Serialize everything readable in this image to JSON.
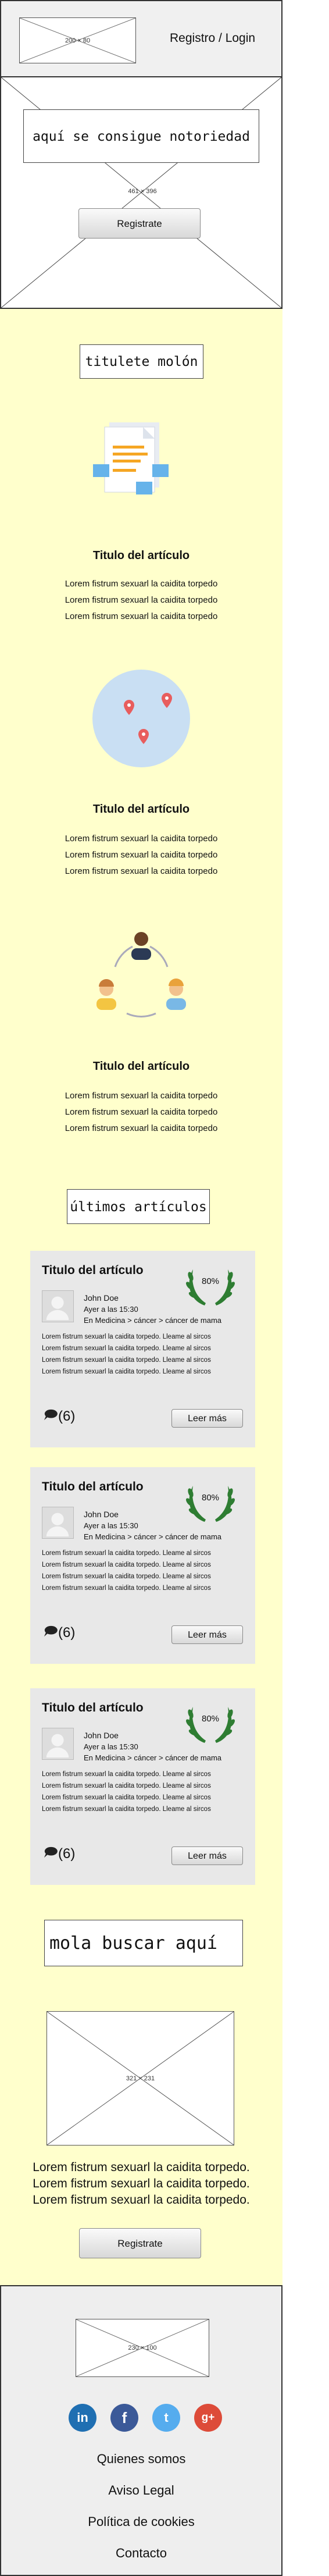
{
  "header": {
    "logo_placeholder": "200 × 80",
    "login_link": "Registro / Login"
  },
  "hero": {
    "headline": "aquí se consigue notoriedad",
    "placeholder_size": "461 × 396",
    "register_button": "Registrate"
  },
  "features": {
    "section_title": "titulete molón",
    "items": [
      {
        "title": "Titulo del artículo",
        "lines": [
          "Lorem fistrum sexuarl la caidita torpedo",
          "Lorem fistrum sexuarl la caidita torpedo",
          "Lorem fistrum sexuarl la caidita torpedo"
        ],
        "icon": "document-icon"
      },
      {
        "title": "Titulo del artículo",
        "lines": [
          "Lorem fistrum sexuarl la caidita torpedo",
          "Lorem fistrum sexuarl la caidita torpedo",
          "Lorem fistrum sexuarl la caidita torpedo"
        ],
        "icon": "map-pins-icon"
      },
      {
        "title": "Titulo del artículo",
        "lines": [
          "Lorem fistrum sexuarl la caidita torpedo",
          "Lorem fistrum sexuarl la caidita torpedo",
          "Lorem fistrum sexuarl la caidita torpedo"
        ],
        "icon": "people-cycle-icon"
      }
    ]
  },
  "latest": {
    "section_title": "últimos artículos",
    "cards": [
      {
        "title": "Titulo del artículo",
        "author": "John Doe",
        "date": "Ayer a las 15:30",
        "category": "En Medicina > cáncer > cáncer de mama",
        "score": "80%",
        "lines": [
          "Lorem fistrum sexuarl la caidita torpedo. Lleame al sircos",
          "Lorem fistrum sexuarl la caidita torpedo. Lleame al sircos",
          "Lorem fistrum sexuarl la caidita torpedo. Lleame al sircos",
          "Lorem fistrum sexuarl la caidita torpedo. Lleame al sircos"
        ],
        "comments": "(6)",
        "read_more": "Leer más"
      },
      {
        "title": "Titulo del artículo",
        "author": "John Doe",
        "date": "Ayer a las 15:30",
        "category": "En Medicina > cáncer > cáncer de mama",
        "score": "80%",
        "lines": [
          "Lorem fistrum sexuarl la caidita torpedo. Lleame al sircos",
          "Lorem fistrum sexuarl la caidita torpedo. Lleame al sircos",
          "Lorem fistrum sexuarl la caidita torpedo. Lleame al sircos",
          "Lorem fistrum sexuarl la caidita torpedo. Lleame al sircos"
        ],
        "comments": "(6)",
        "read_more": "Leer más"
      },
      {
        "title": "Titulo del artículo",
        "author": "John Doe",
        "date": "Ayer a las 15:30",
        "category": "En Medicina > cáncer > cáncer de mama",
        "score": "80%",
        "lines": [
          "Lorem fistrum sexuarl la caidita torpedo. Lleame al sircos",
          "Lorem fistrum sexuarl la caidita torpedo. Lleame al sircos",
          "Lorem fistrum sexuarl la caidita torpedo. Lleame al sircos",
          "Lorem fistrum sexuarl la caidita torpedo. Lleame al sircos"
        ],
        "comments": "(6)",
        "read_more": "Leer más"
      }
    ]
  },
  "search_section": {
    "title": "mola buscar aquí",
    "placeholder_size": "321 × 231",
    "lines": [
      "Lorem fistrum sexuarl la caidita torpedo.",
      "Lorem fistrum sexuarl la caidita torpedo.",
      "Lorem fistrum sexuarl la caidita torpedo."
    ],
    "register_button": "Registrate"
  },
  "footer": {
    "logo_placeholder": "230 × 100",
    "social": [
      {
        "name": "linkedin-icon",
        "glyph": "in",
        "color": "#1f6fb2"
      },
      {
        "name": "facebook-icon",
        "glyph": "f",
        "color": "#3b5998"
      },
      {
        "name": "twitter-icon",
        "glyph": "t",
        "color": "#55acee"
      },
      {
        "name": "google-plus-icon",
        "glyph": "g+",
        "color": "#dd4b39"
      }
    ],
    "links": [
      "Quienes somos",
      "Aviso Legal",
      "Política de cookies",
      "Contacto"
    ]
  },
  "colors": {
    "page_bg_yellow": "#ffffcc",
    "header_bg": "#f0f0f0",
    "footer_bg": "#eeeeee",
    "card_bg": "#e8e8e8",
    "laurel": "#2e7d32"
  }
}
